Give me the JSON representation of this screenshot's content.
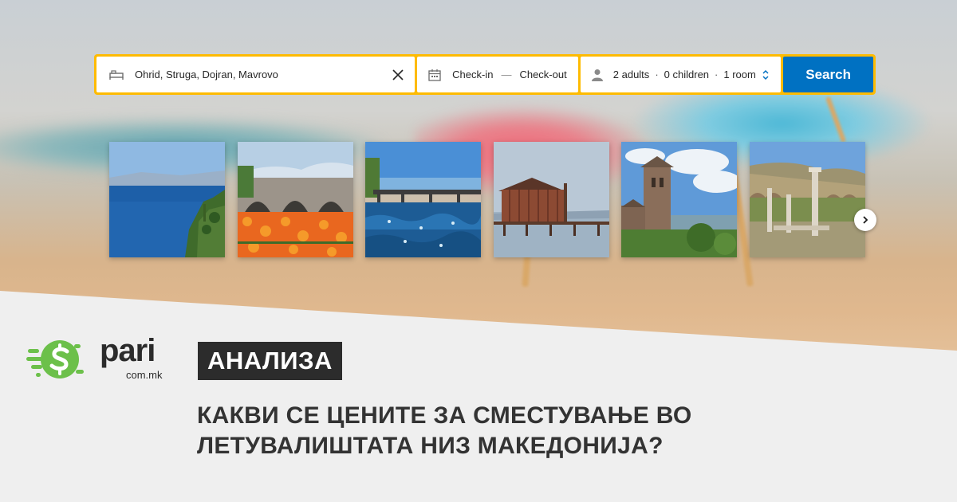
{
  "search": {
    "destination_value": "Ohrid, Struga, Dojran, Mavrovo",
    "check_in_label": "Check-in",
    "date_separator": "—",
    "check_out_label": "Check-out",
    "adults_label": "2 adults",
    "children_label": "0 children",
    "rooms_label": "1 room",
    "guest_separator": "·",
    "search_button_label": "Search"
  },
  "gallery": {
    "photos": [
      "lake-ohrid-coast-photo",
      "stone-bridge-flowers-photo",
      "river-bridge-photo",
      "wooden-boathouse-photo",
      "stone-church-photo",
      "ancient-ruins-photo"
    ]
  },
  "brand": {
    "name": "pari",
    "domain": "com.mk"
  },
  "article": {
    "tag": "АНАЛИЗА",
    "headline_line1": "КАКВИ СЕ ЦЕНИТЕ ЗА СМЕСТУВАЊЕ ВО",
    "headline_line2": "ЛЕТУВАЛИШТАТА НИЗ МАКЕДОНИЈА?"
  },
  "colors": {
    "search_border": "#febb02",
    "search_button": "#0071c2",
    "brand_green": "#6cc04a",
    "tag_background": "#2c2c2c"
  }
}
